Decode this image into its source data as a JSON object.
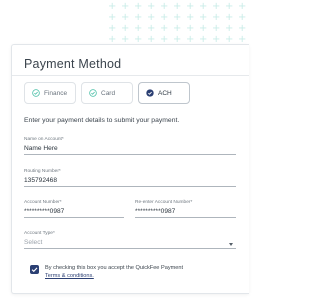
{
  "payment": {
    "title": "Payment Method",
    "methods": [
      {
        "label": "Finance",
        "icon": "check-circle-icon",
        "selected": false
      },
      {
        "label": "Card",
        "icon": "check-circle-icon",
        "selected": false
      },
      {
        "label": "ACH",
        "icon": "check-circle-filled-icon",
        "selected": true
      }
    ],
    "instructions": "Enter your payment details to submit your payment.",
    "fields": {
      "name_on_account": {
        "label": "Name on Account*",
        "value": "Name Here"
      },
      "routing_number": {
        "label": "Routing Number*",
        "value": "135792468"
      },
      "account_number": {
        "label": "Account Number*",
        "value": "**********0987"
      },
      "reenter_account_number": {
        "label": "Re-enter Account Number*",
        "value": "**********0987"
      },
      "account_type": {
        "label": "Account Type*",
        "placeholder": "Select"
      }
    },
    "consent": {
      "checked": true,
      "text": "By checking this box you accept the QuickFee Payment",
      "link_text": "Terms & conditions."
    }
  },
  "colors": {
    "accent": "#2b3f73",
    "check_green": "#4cc0a8",
    "pattern": "#c9ece8"
  }
}
